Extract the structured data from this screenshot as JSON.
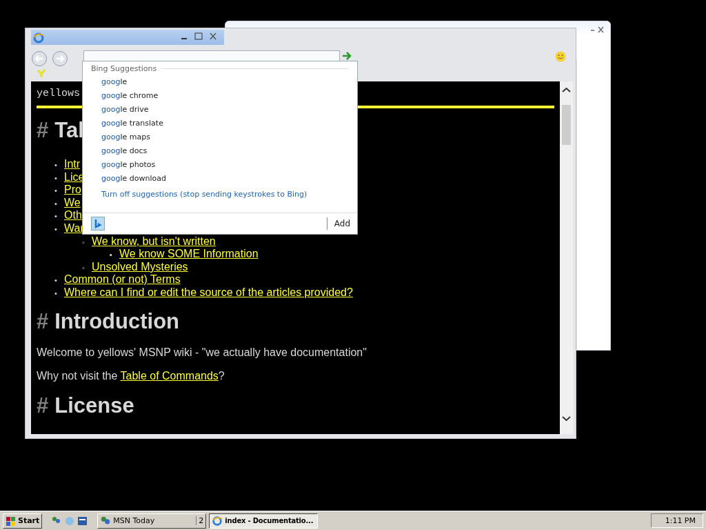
{
  "browser": {
    "suggestions": {
      "heading": "Bing Suggestions",
      "items": [
        {
          "match": "goog",
          "rest": "le"
        },
        {
          "match": "goog",
          "rest": "le chrome"
        },
        {
          "match": "goog",
          "rest": "le drive"
        },
        {
          "match": "goog",
          "rest": "le translate"
        },
        {
          "match": "goog",
          "rest": "le maps"
        },
        {
          "match": "goog",
          "rest": "le docs"
        },
        {
          "match": "goog",
          "rest": "le photos"
        },
        {
          "match": "goog",
          "rest": "le download"
        }
      ],
      "turn_off": "Turn off suggestions (stop sending keystrokes to Bing)",
      "add_button": "Add"
    },
    "page": {
      "site_title": "yellows",
      "toc_heading": {
        "hash": "#",
        "text": "Tal"
      },
      "toc": [
        {
          "marker": "•",
          "label": "Intr"
        },
        {
          "marker": "•",
          "label": "Lice"
        },
        {
          "marker": "•",
          "label": "Pro"
        },
        {
          "marker": "•",
          "label": "We"
        },
        {
          "marker": "•",
          "label": "Oth"
        },
        {
          "marker": "•",
          "label": "War",
          "children": [
            {
              "marker": "◦",
              "label": "We know, but isn't written",
              "children": [
                {
                  "marker": "▪",
                  "label": "We know SOME Information"
                }
              ]
            },
            {
              "marker": "◦",
              "label": "Unsolved Mysteries"
            }
          ]
        },
        {
          "marker": "•",
          "label": "Common (or not) Terms"
        },
        {
          "marker": "•",
          "label": "Where can I find or edit the source of the articles provided?"
        }
      ],
      "sections": [
        {
          "hash": "#",
          "heading": "Introduction",
          "paragraphs": [
            {
              "text": "Welcome to yellows' MSNP wiki - \"we actually have documentation\""
            },
            {
              "text": "Why not visit the ",
              "link": "Table of Commands",
              "after": "?"
            }
          ]
        },
        {
          "hash": "#",
          "heading": "License"
        }
      ]
    }
  },
  "taskbar": {
    "start": "Start",
    "tasks": [
      {
        "label": "MSN Today",
        "count": "2",
        "selected": false
      },
      {
        "label": "index - Documentatio...",
        "selected": true
      }
    ],
    "clock": "1:11 PM"
  }
}
